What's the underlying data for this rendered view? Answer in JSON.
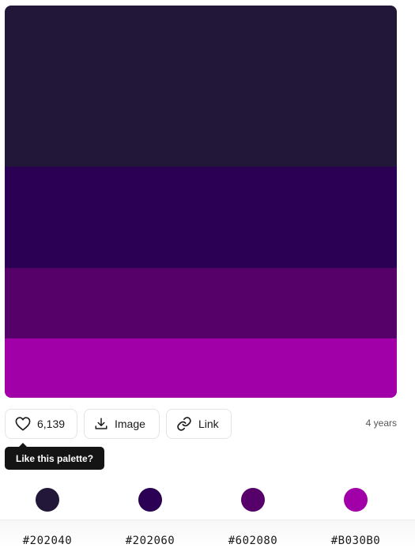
{
  "palette": {
    "colors": [
      {
        "hex": "#202040",
        "fill": "#221639"
      },
      {
        "hex": "#202060",
        "fill": "#2b0054"
      },
      {
        "hex": "#602080",
        "fill": "#560069"
      },
      {
        "hex": "#B030B0",
        "fill": "#a100a8"
      }
    ]
  },
  "actions": {
    "like_count": "6,139",
    "image_label": "Image",
    "link_label": "Link",
    "age": "4 years"
  },
  "tooltip": {
    "text": "Like this palette?"
  },
  "icons": {
    "like": "heart-icon",
    "image": "download-icon",
    "link": "link-icon"
  }
}
